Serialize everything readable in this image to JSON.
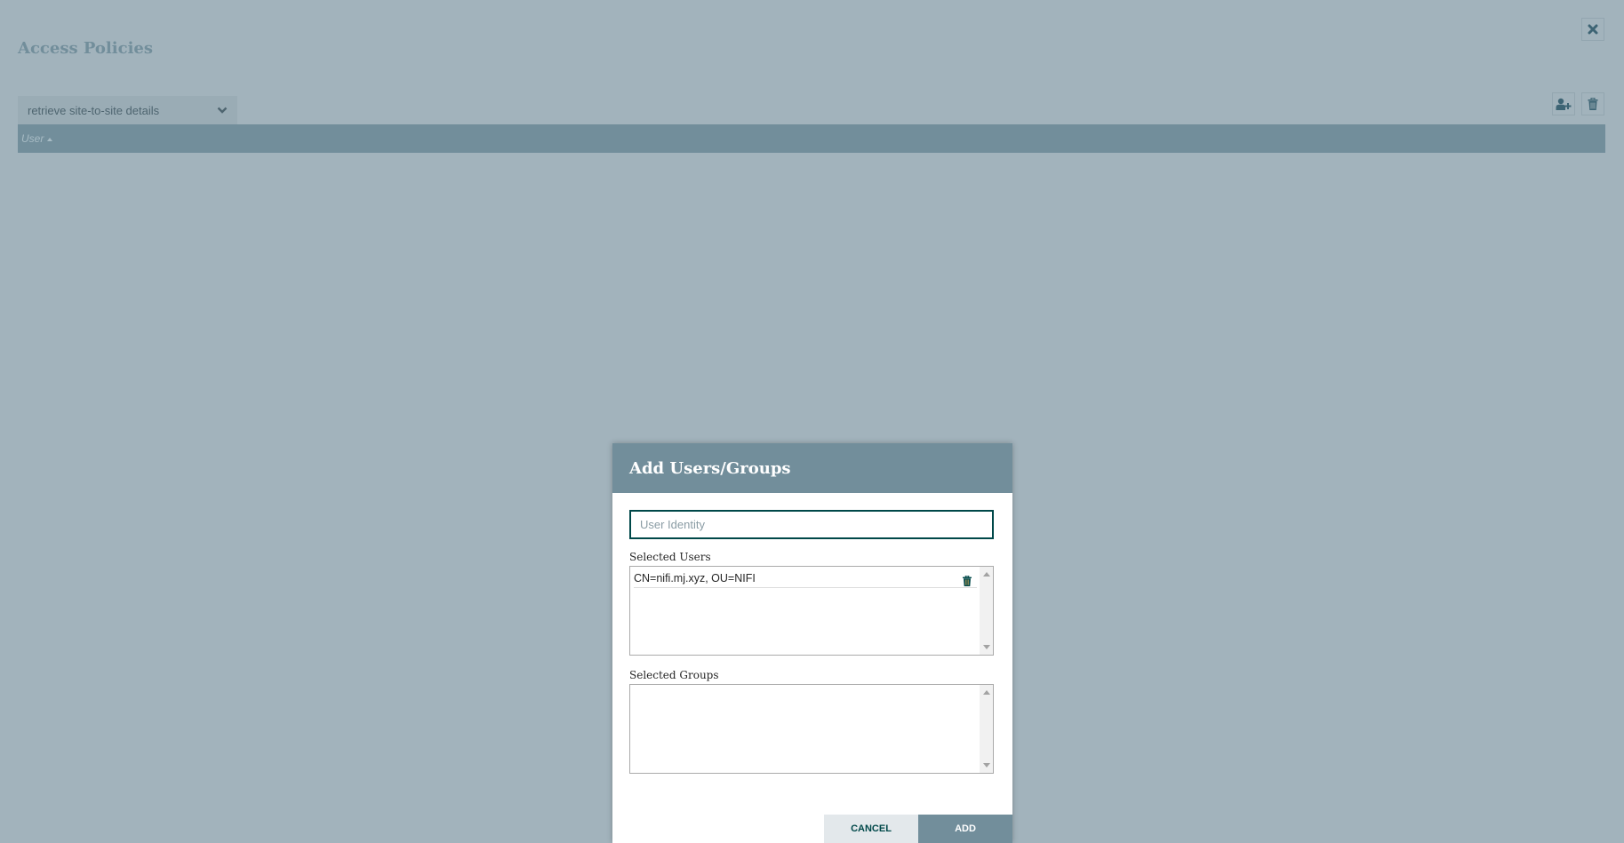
{
  "page": {
    "title": "Access Policies",
    "close_icon": "close-icon"
  },
  "toolbar": {
    "policy_select_value": "retrieve site-to-site details",
    "add_user_icon": "user-plus-icon",
    "delete_icon": "trash-icon"
  },
  "table": {
    "columns": [
      {
        "label": "User",
        "sort": "ascending"
      }
    ],
    "rows": []
  },
  "dialog": {
    "title": "Add Users/Groups",
    "identity_placeholder": "User Identity",
    "identity_value": "",
    "selected_users_label": "Selected Users",
    "selected_users": [
      {
        "name": "CN=nifi.mj.xyz, OU=NIFI"
      }
    ],
    "selected_groups_label": "Selected Groups",
    "selected_groups": [],
    "cancel_label": "CANCEL",
    "add_label": "ADD"
  },
  "colors": {
    "background_overlay": "#a2b3bc",
    "header": "#728e9b",
    "accent": "#004849"
  }
}
